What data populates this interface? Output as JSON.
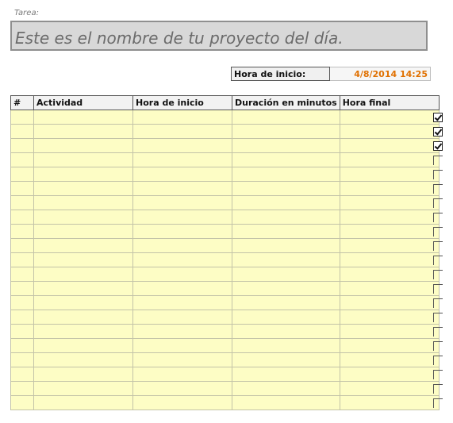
{
  "task": {
    "label": "Tarea:",
    "value": "Este es el nombre de tu proyecto del día."
  },
  "start": {
    "label": "Hora de inicio:",
    "value": "4/8/2014 14:25"
  },
  "table": {
    "headers": [
      "#",
      "Actividad",
      "Hora de inicio",
      "Duración en minutos",
      "Hora final"
    ],
    "row_count": 21,
    "rows_checked": [
      true,
      true,
      true,
      false,
      false,
      false,
      false,
      false,
      false,
      false,
      false,
      false,
      false,
      false,
      false,
      false,
      false,
      false,
      false,
      false,
      false
    ]
  },
  "colors": {
    "row_fill": "#fdfdc5",
    "start_value": "#e07000"
  },
  "icons": {
    "checked": "checkbox-checked-icon",
    "unchecked": "checkbox-unchecked-icon"
  }
}
